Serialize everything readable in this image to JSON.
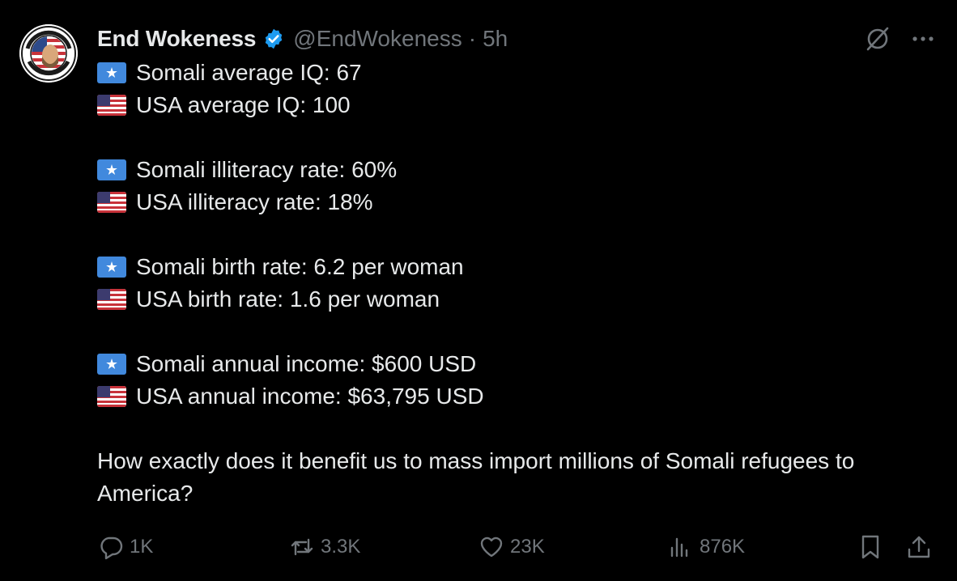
{
  "tweet": {
    "author": {
      "display_name": "End Wokeness",
      "handle": "@EndWokeness",
      "separator": "·",
      "time_ago": "5h",
      "verified": true,
      "avatar_text_top": "I SUPPORT THE",
      "avatar_text_bottom": "FORMER THING"
    },
    "lines": [
      {
        "flag": "somalia-flag-icon",
        "text": "Somali average IQ: 67"
      },
      {
        "flag": "usa-flag-icon",
        "text": "USA average IQ: 100"
      },
      {
        "flag": "somalia-flag-icon",
        "text": "Somali illiteracy rate: 60%"
      },
      {
        "flag": "usa-flag-icon",
        "text": "USA illiteracy rate: 18%"
      },
      {
        "flag": "somalia-flag-icon",
        "text": "Somali birth rate: 6.2 per woman"
      },
      {
        "flag": "usa-flag-icon",
        "text": "USA birth rate: 1.6 per woman"
      },
      {
        "flag": "somalia-flag-icon",
        "text": "Somali annual income: $600 USD"
      },
      {
        "flag": "usa-flag-icon",
        "text": "USA annual income: $63,795 USD"
      }
    ],
    "closing_text": "How exactly does it benefit us to mass import millions of Somali refugees to America?",
    "stats": {
      "replies": "1K",
      "reposts": "3.3K",
      "likes": "23K",
      "views": "876K"
    }
  },
  "colors": {
    "background": "#000000",
    "text_primary": "#e7e9ea",
    "text_secondary": "#71767b",
    "verified_blue": "#1d9bf0",
    "somalia_blue": "#4189dd"
  }
}
